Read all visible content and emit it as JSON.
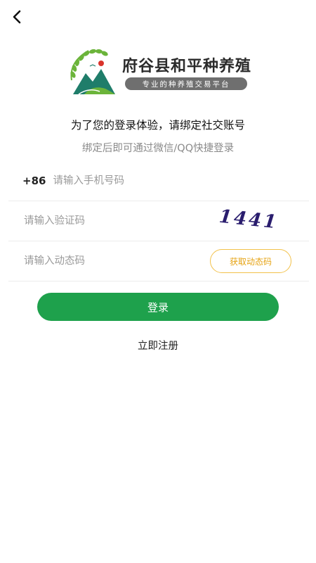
{
  "nav": {
    "back_icon": "chevron-left-icon"
  },
  "brand": {
    "title": "府谷县和平种养殖",
    "slogan": "专业的种养殖交易平台",
    "emblem_icon": "rice-mountain-logo"
  },
  "intro": {
    "headline": "为了您的登录体验，请绑定社交账号",
    "subline": "绑定后即可通过微信/QQ快捷登录"
  },
  "form": {
    "phone": {
      "prefix": "+86",
      "placeholder": "请输入手机号码",
      "value": ""
    },
    "captcha": {
      "placeholder": "请输入验证码",
      "value": "",
      "image_text": "1441"
    },
    "sms": {
      "placeholder": "请输入动态码",
      "value": "",
      "button_label": "获取动态码"
    }
  },
  "actions": {
    "login_label": "登录",
    "register_label": "立即注册"
  },
  "colors": {
    "primary": "#1ea14c",
    "accent": "#f2c14a",
    "captcha_text": "#2a1d6e"
  }
}
